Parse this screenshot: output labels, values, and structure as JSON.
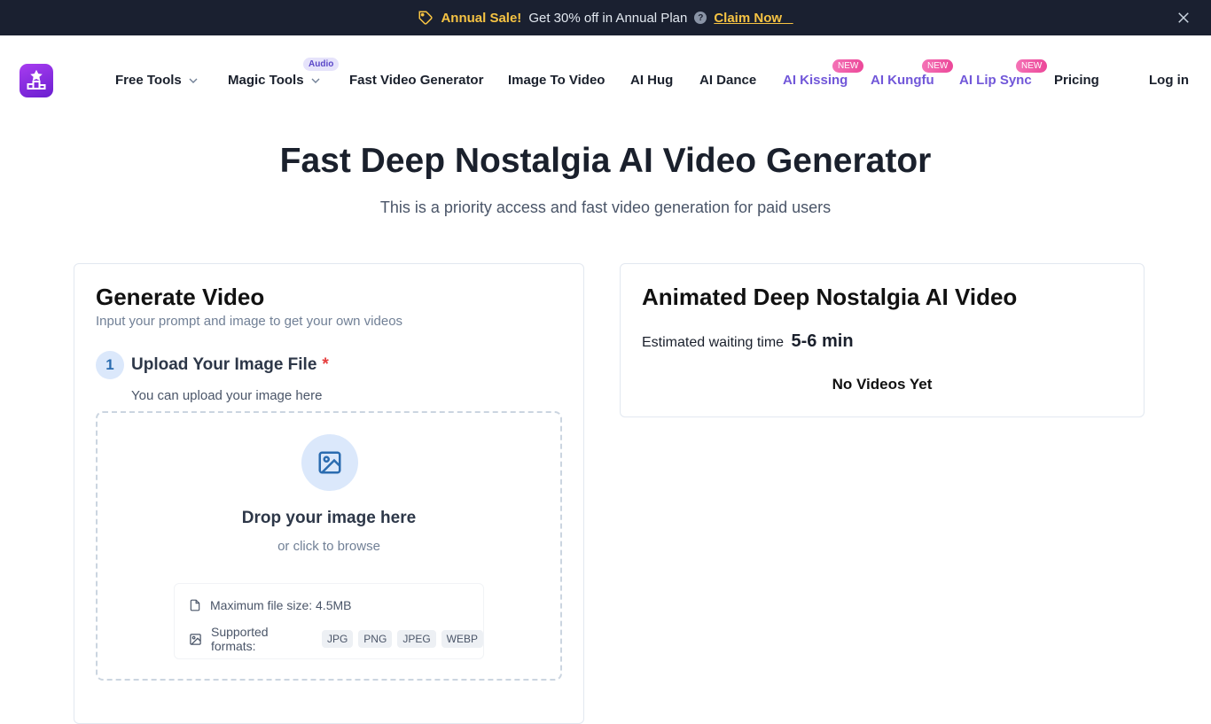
{
  "banner": {
    "sale": "Annual Sale!",
    "offer": "Get 30% off in Annual Plan",
    "help": "?",
    "claim": "Claim Now _"
  },
  "nav": {
    "items": [
      {
        "label": "Free Tools"
      },
      {
        "label": "Magic Tools",
        "badge": "Audio"
      },
      {
        "label": "Fast Video Generator"
      },
      {
        "label": "Image To Video"
      },
      {
        "label": "AI Hug"
      },
      {
        "label": "AI Dance"
      },
      {
        "label": "AI Kissing",
        "badge": "NEW"
      },
      {
        "label": "AI Kungfu",
        "badge": "NEW"
      },
      {
        "label": "AI Lip Sync",
        "badge": "NEW"
      },
      {
        "label": "Pricing"
      }
    ],
    "login": "Log in"
  },
  "hero": {
    "title": "Fast Deep Nostalgia AI Video Generator",
    "subtitle": "This is a priority access and fast video generation for paid users"
  },
  "generate": {
    "title": "Generate Video",
    "subtitle": "Input your prompt and image to get your own videos",
    "step": {
      "number": "1",
      "title": "Upload Your Image File",
      "required": "*",
      "subtitle": "You can upload your image here"
    },
    "dropzone": {
      "title": "Drop your image here",
      "subtitle": "or click to browse",
      "max_size": "Maximum file size: 4.5MB",
      "formats_label": "Supported formats:",
      "formats": [
        "JPG",
        "PNG",
        "JPEG",
        "WEBP"
      ]
    }
  },
  "result": {
    "title": "Animated Deep Nostalgia AI Video",
    "wait_label": "Estimated waiting time",
    "wait_value": "5-6 min",
    "empty": "No Videos Yet"
  },
  "colors": {
    "banner_bg": "#1a2030",
    "sale_accent": "#f6c343",
    "nav_purple": "#7157d9",
    "new_badge": "#ec4899",
    "step_blue": "#2b6cb0"
  }
}
